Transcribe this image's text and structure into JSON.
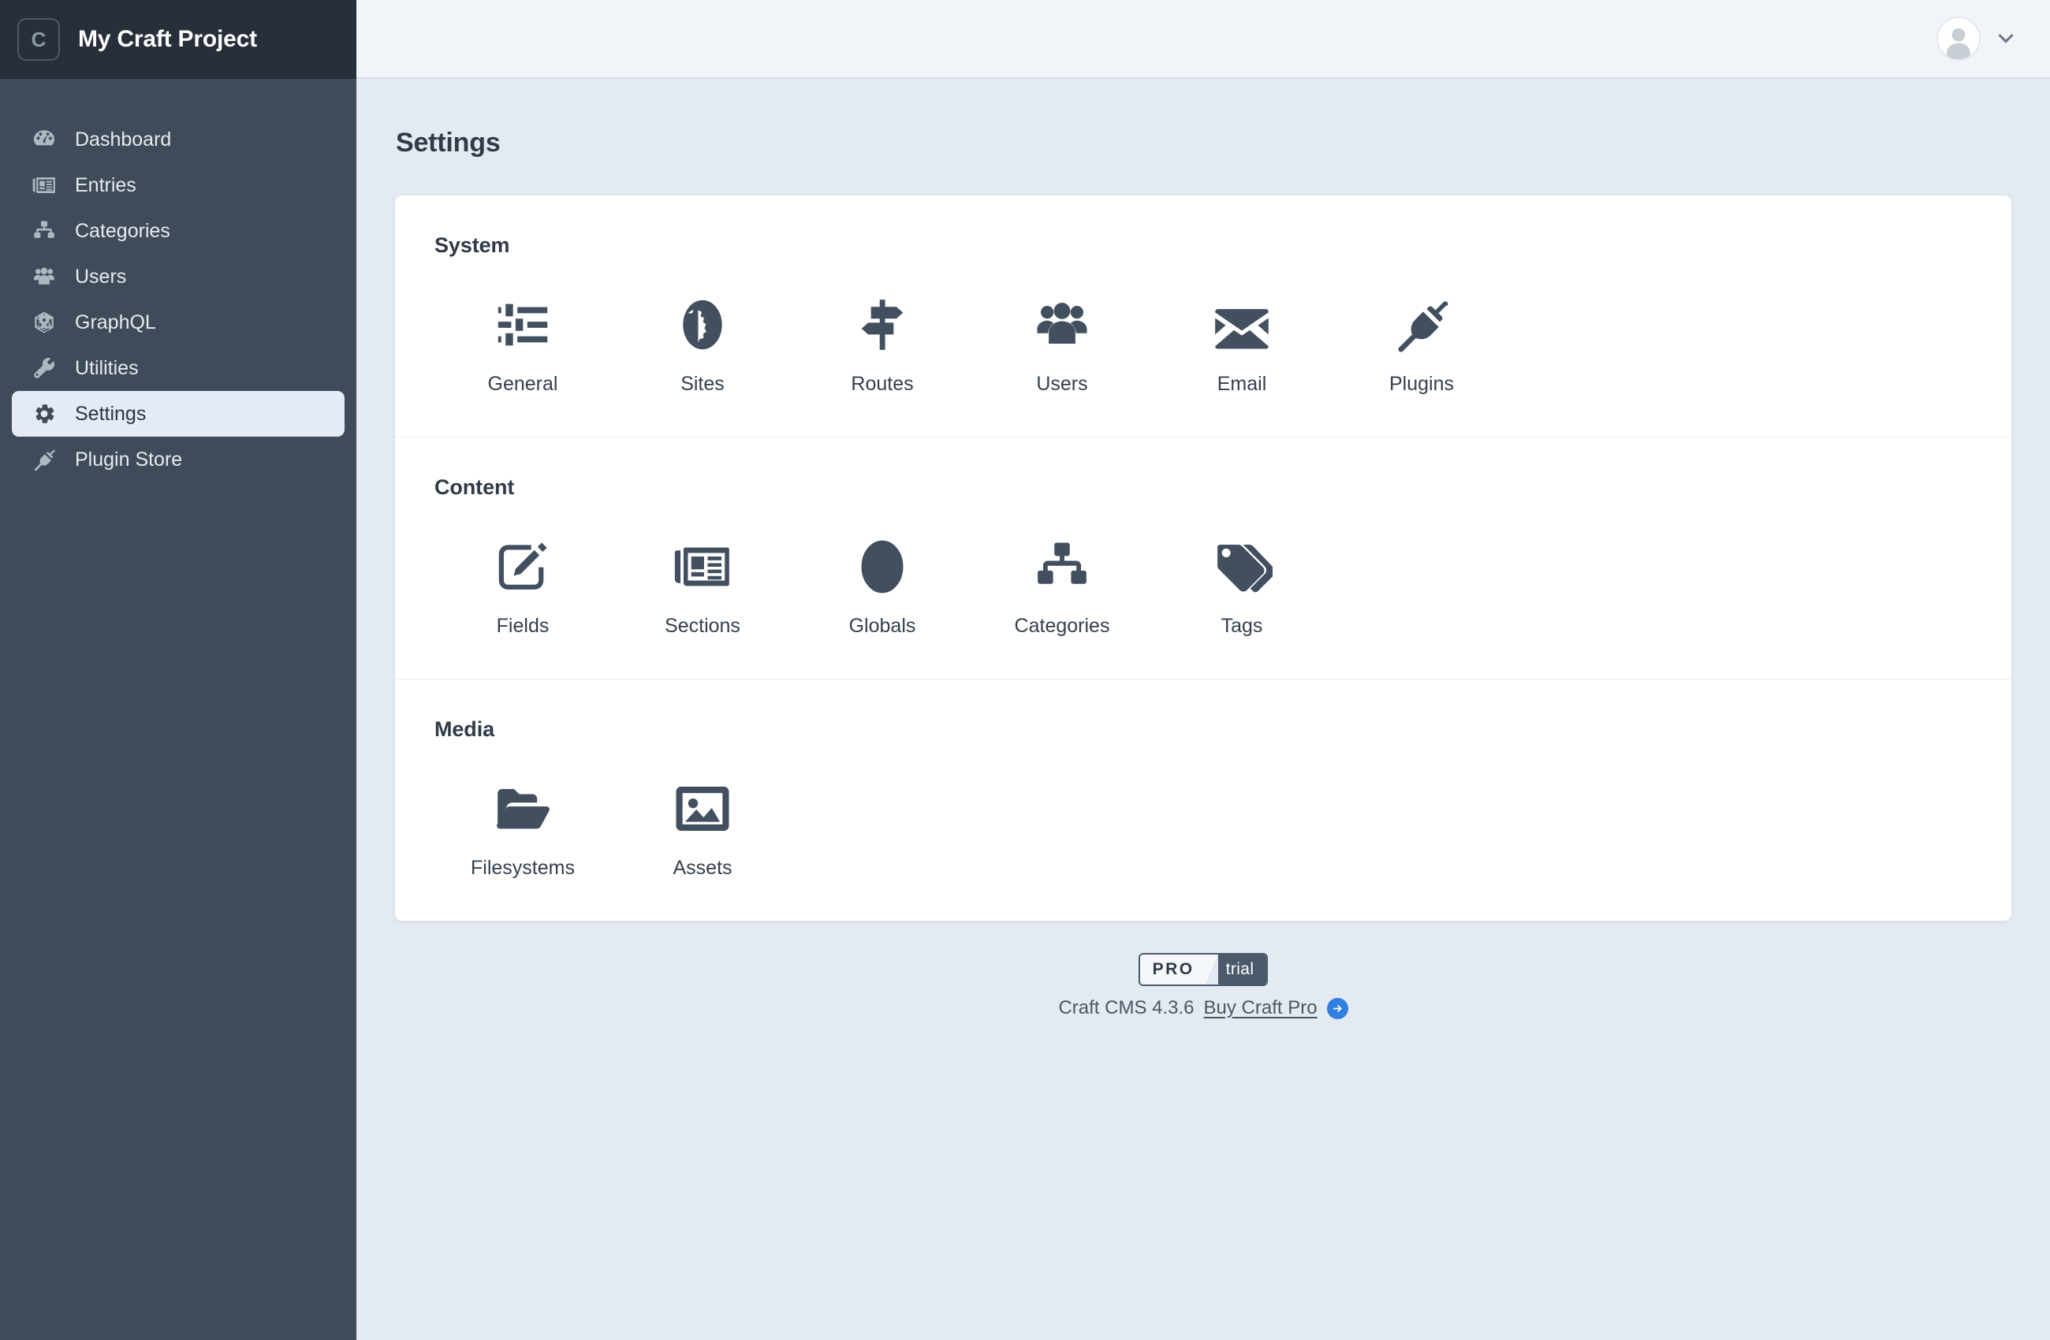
{
  "sidebar": {
    "logo_letter": "C",
    "project_title": "My Craft Project",
    "items": [
      {
        "label": "Dashboard",
        "icon": "dashboard-icon",
        "active": false
      },
      {
        "label": "Entries",
        "icon": "newspaper-icon",
        "active": false
      },
      {
        "label": "Categories",
        "icon": "sitemap-icon",
        "active": false
      },
      {
        "label": "Users",
        "icon": "users-icon",
        "active": false
      },
      {
        "label": "GraphQL",
        "icon": "graphql-icon",
        "active": false
      },
      {
        "label": "Utilities",
        "icon": "wrench-icon",
        "active": false
      },
      {
        "label": "Settings",
        "icon": "gear-icon",
        "active": true
      },
      {
        "label": "Plugin Store",
        "icon": "plug-icon",
        "active": false
      }
    ]
  },
  "topbar": {
    "avatar_name": "user-avatar",
    "chevron_name": "chevron-down-icon"
  },
  "page": {
    "title": "Settings"
  },
  "sections": [
    {
      "title": "System",
      "tiles": [
        {
          "label": "General",
          "icon": "sliders-icon"
        },
        {
          "label": "Sites",
          "icon": "globe-americas-icon"
        },
        {
          "label": "Routes",
          "icon": "signpost-icon"
        },
        {
          "label": "Users",
          "icon": "users-icon"
        },
        {
          "label": "Email",
          "icon": "envelope-icon"
        },
        {
          "label": "Plugins",
          "icon": "plug-icon"
        }
      ]
    },
    {
      "title": "Content",
      "tiles": [
        {
          "label": "Fields",
          "icon": "pencil-square-icon"
        },
        {
          "label": "Sections",
          "icon": "newspaper-icon"
        },
        {
          "label": "Globals",
          "icon": "globe-grid-icon"
        },
        {
          "label": "Categories",
          "icon": "sitemap-icon"
        },
        {
          "label": "Tags",
          "icon": "tags-icon"
        }
      ]
    },
    {
      "title": "Media",
      "tiles": [
        {
          "label": "Filesystems",
          "icon": "folder-open-icon"
        },
        {
          "label": "Assets",
          "icon": "image-icon"
        }
      ]
    }
  ],
  "footer": {
    "edition_pro": "PRO",
    "edition_trial": "trial",
    "version_text": "Craft CMS 4.3.6",
    "buy_label": "Buy Craft Pro",
    "accent_color": "#2f7fe0"
  }
}
